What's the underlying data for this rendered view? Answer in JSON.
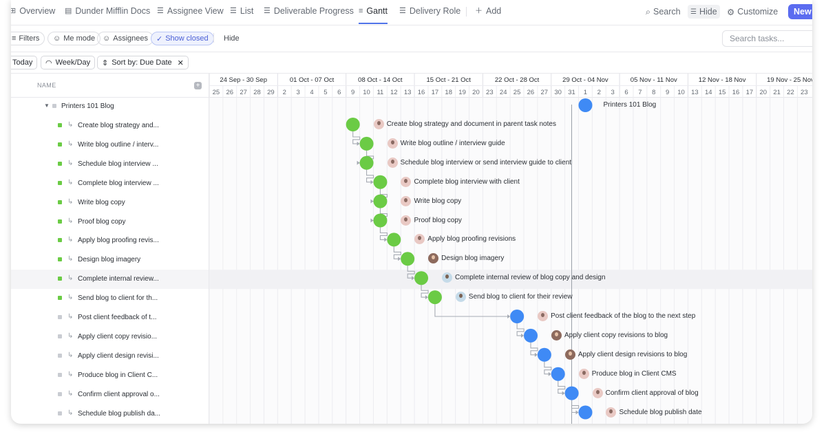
{
  "tabs": [
    {
      "label": "Overview",
      "icon": "overview-icon",
      "glyph": "⊞"
    },
    {
      "label": "Dunder Mifflin Docs",
      "icon": "doc-icon",
      "glyph": "▤"
    },
    {
      "label": "Assignee View",
      "icon": "list-icon",
      "glyph": "☰"
    },
    {
      "label": "List",
      "icon": "list-icon",
      "glyph": "☰"
    },
    {
      "label": "Deliverable Progress",
      "icon": "list-icon",
      "glyph": "☰"
    },
    {
      "label": "Gantt",
      "icon": "gantt-icon",
      "glyph": "≡",
      "active": true
    },
    {
      "label": "Delivery Role",
      "icon": "list-icon",
      "glyph": "☰"
    }
  ],
  "add_view_label": "Add",
  "toolbar": {
    "search_label": "Search",
    "hide_label": "Hide",
    "customize_label": "Customize",
    "new_label": "New"
  },
  "filters": {
    "filters_label": "Filters",
    "me_mode_label": "Me mode",
    "assignees_label": "Assignees",
    "show_closed_label": "Show closed",
    "hide_label": "Hide",
    "search_placeholder": "Search tasks..."
  },
  "controls": {
    "today_label": "Today",
    "week_day_label": "Week/Day",
    "sort_label": "Sort by: Due Date"
  },
  "name_header": "NAME",
  "weeks": [
    "24 Sep - 30 Sep",
    "01 Oct - 07 Oct",
    "08 Oct - 14 Oct",
    "15 Oct - 21 Oct",
    "22 Oct - 28 Oct",
    "29 Oct - 04 Nov",
    "05 Nov - 11 Nov",
    "12 Nov - 18 Nov",
    "19 Nov - 25 Nov"
  ],
  "days": [
    "25",
    "26",
    "27",
    "28",
    "29",
    "2",
    "3",
    "4",
    "5",
    "6",
    "9",
    "10",
    "11",
    "12",
    "13",
    "16",
    "17",
    "18",
    "19",
    "20",
    "23",
    "24",
    "25",
    "26",
    "27",
    "30",
    "31",
    "1",
    "2",
    "3",
    "6",
    "7",
    "8",
    "9",
    "10",
    "13",
    "14",
    "15",
    "16",
    "17",
    "20",
    "21",
    "22",
    "23"
  ],
  "colors": {
    "done": "#6bcb45",
    "todo": "#3f8af5",
    "accent": "#4f73e8",
    "today_line": "#9aa0a8"
  },
  "parent": {
    "name": "Printers 101 Blog",
    "col": 27
  },
  "tasks": [
    {
      "short": "Create blog strategy and...",
      "full": "Create blog strategy and document in parent task notes",
      "status": "done",
      "col": 10,
      "avatar": "light"
    },
    {
      "short": "Write blog outline / interv...",
      "full": "Write blog outline / interview guide",
      "status": "done",
      "col": 11,
      "avatar": "light"
    },
    {
      "short": "Schedule blog interview ...",
      "full": "Schedule blog interview or send interview guide to client",
      "status": "done",
      "col": 11,
      "avatar": "light"
    },
    {
      "short": "Complete blog interview ...",
      "full": "Complete blog interview with client",
      "status": "done",
      "col": 12,
      "avatar": "light"
    },
    {
      "short": "Write blog copy",
      "full": "Write blog copy",
      "status": "done",
      "col": 12,
      "avatar": "light"
    },
    {
      "short": "Proof blog copy",
      "full": "Proof blog copy",
      "status": "done",
      "col": 12,
      "avatar": "light"
    },
    {
      "short": "Apply blog proofing revis...",
      "full": "Apply blog proofing revisions",
      "status": "done",
      "col": 13,
      "avatar": "light"
    },
    {
      "short": "Design blog imagery",
      "full": "Design blog imagery",
      "status": "done",
      "col": 14,
      "avatar": "dark"
    },
    {
      "short": "Complete internal review...",
      "full": "Complete internal review of blog copy and design",
      "status": "done",
      "col": 15,
      "avatar": "blue",
      "highlight": true
    },
    {
      "short": "Send blog to client for th...",
      "full": "Send blog to client for their review",
      "status": "done",
      "col": 16,
      "avatar": "blue"
    },
    {
      "short": "Post client feedback of t...",
      "full": "Post client feedback of the blog to the next step",
      "status": "todo",
      "col": 22,
      "avatar": "light"
    },
    {
      "short": "Apply client copy revisio...",
      "full": "Apply client copy revisions to blog",
      "status": "todo",
      "col": 23,
      "avatar": "dark"
    },
    {
      "short": "Apply client design revisi...",
      "full": "Apply client design revisions to blog",
      "status": "todo",
      "col": 24,
      "avatar": "dark"
    },
    {
      "short": "Produce blog in Client C...",
      "full": "Produce blog in Client CMS",
      "status": "todo",
      "col": 25,
      "avatar": "light"
    },
    {
      "short": "Confirm client approval o...",
      "full": "Confirm client approval of blog",
      "status": "todo",
      "col": 26,
      "avatar": "light"
    },
    {
      "short": "Schedule blog publish da...",
      "full": "Schedule blog publish date",
      "status": "todo",
      "col": 27,
      "avatar": "light"
    }
  ]
}
